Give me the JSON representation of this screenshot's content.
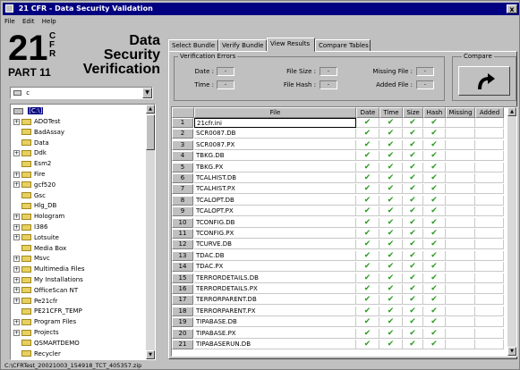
{
  "window": {
    "title": "21 CFR  -  Data Security Validation",
    "close": "x"
  },
  "menu": [
    "File",
    "Edit",
    "Help"
  ],
  "logo": {
    "big": "21",
    "cfr": [
      "C",
      "F",
      "R"
    ],
    "part": "PART 11",
    "data": [
      "Data",
      "Security",
      "Verification"
    ]
  },
  "drive": "c",
  "tree": {
    "root": "[C:\\]",
    "items": [
      {
        "label": "ADOTest",
        "expand": "+"
      },
      {
        "label": "BadAssay",
        "expand": ""
      },
      {
        "label": "Data",
        "expand": ""
      },
      {
        "label": "Ddk",
        "expand": "+"
      },
      {
        "label": "Esm2",
        "expand": ""
      },
      {
        "label": "Fire",
        "expand": "+"
      },
      {
        "label": "gcf520",
        "expand": "+"
      },
      {
        "label": "Gsc",
        "expand": ""
      },
      {
        "label": "Hlg_DB",
        "expand": ""
      },
      {
        "label": "Hologram",
        "expand": "+"
      },
      {
        "label": "I386",
        "expand": "+"
      },
      {
        "label": "Lotsuite",
        "expand": "+"
      },
      {
        "label": "Media Box",
        "expand": ""
      },
      {
        "label": "Msvc",
        "expand": "+"
      },
      {
        "label": "Multimedia Files",
        "expand": "+"
      },
      {
        "label": "My Installations",
        "expand": "+"
      },
      {
        "label": "OfficeScan NT",
        "expand": "+"
      },
      {
        "label": "Pe21cfr",
        "expand": "+"
      },
      {
        "label": "PE21CFR_TEMP",
        "expand": ""
      },
      {
        "label": "Program Files",
        "expand": "+"
      },
      {
        "label": "Projects",
        "expand": "+"
      },
      {
        "label": "QSMARTDEMO",
        "expand": ""
      },
      {
        "label": "Recycler",
        "expand": ""
      }
    ]
  },
  "tabs": [
    "Select Bundle",
    "Verify Bundle",
    "View Results",
    "Compare Tables"
  ],
  "active_tab": "View Results",
  "verification": {
    "legend": "Verification Errors",
    "date_label": "Date :",
    "time_label": "Time :",
    "size_label": "File Size :",
    "hash_label": "File Hash :",
    "missing_label": "Missing File :",
    "added_label": "Added File :",
    "empty_value": "-"
  },
  "compare": {
    "legend": "Compare"
  },
  "grid": {
    "columns": [
      "File",
      "Date",
      "Time",
      "Size",
      "Hash",
      "Missing",
      "Added"
    ],
    "check": "✔",
    "rows": [
      {
        "n": "1",
        "file": "21cfr.ini"
      },
      {
        "n": "2",
        "file": "SCR0087.DB"
      },
      {
        "n": "3",
        "file": "SCR0087.PX"
      },
      {
        "n": "4",
        "file": "TBKG.DB"
      },
      {
        "n": "5",
        "file": "TBKG.PX"
      },
      {
        "n": "6",
        "file": "TCALHIST.DB"
      },
      {
        "n": "7",
        "file": "TCALHIST.PX"
      },
      {
        "n": "8",
        "file": "TCALOPT.DB"
      },
      {
        "n": "9",
        "file": "TCALOPT.PX"
      },
      {
        "n": "10",
        "file": "TCONFIG.DB"
      },
      {
        "n": "11",
        "file": "TCONFIG.PX"
      },
      {
        "n": "12",
        "file": "TCURVE.DB"
      },
      {
        "n": "13",
        "file": "TDAC.DB"
      },
      {
        "n": "14",
        "file": "TDAC.PX"
      },
      {
        "n": "15",
        "file": "TERRORDETAILS.DB"
      },
      {
        "n": "16",
        "file": "TERRORDETAILS.PX"
      },
      {
        "n": "17",
        "file": "TERRORPARENT.DB"
      },
      {
        "n": "18",
        "file": "TERRORPARENT.PX"
      },
      {
        "n": "19",
        "file": "TIPABASE.DB"
      },
      {
        "n": "20",
        "file": "TIPABASE.PX"
      },
      {
        "n": "21",
        "file": "TIPABASERUN.DB"
      }
    ]
  },
  "status": "C:\\CFRTest_20021003_154918_TCT_405357.zip",
  "colors": {
    "title_bar": "#000080",
    "check": "#2a9a20",
    "folder": "#e8d060"
  }
}
